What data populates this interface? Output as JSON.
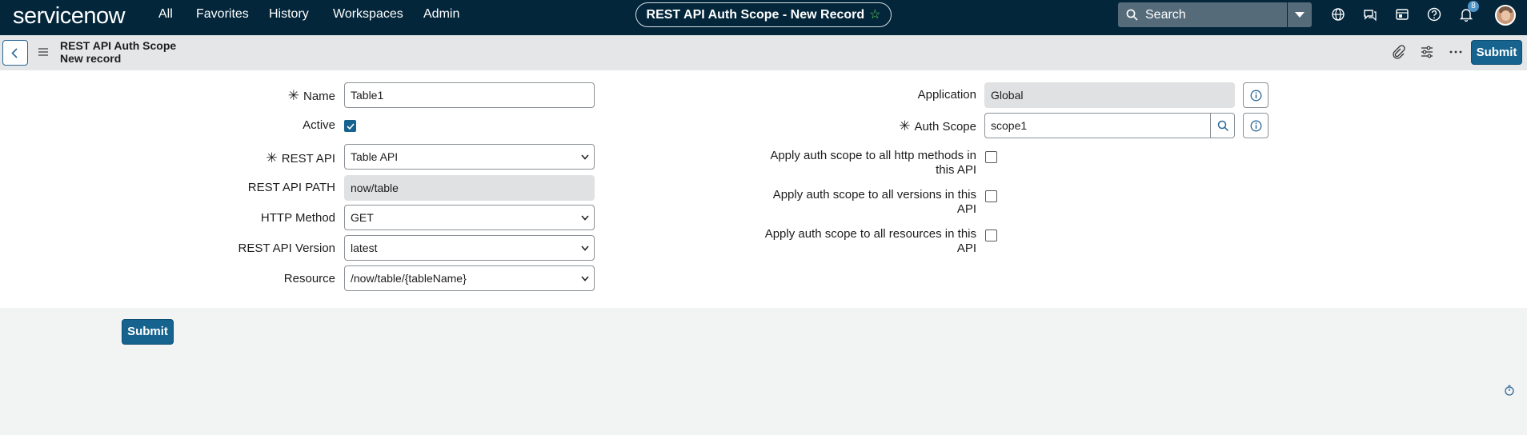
{
  "topbar": {
    "logo": "servicenow",
    "nav": [
      "All",
      "Favorites",
      "History",
      "Workspaces",
      "Admin"
    ],
    "record_title": "REST API Auth Scope - New Record",
    "search_placeholder": "Search",
    "notification_count": "8"
  },
  "subheader": {
    "title_line1": "REST API Auth Scope",
    "title_line2": "New record",
    "submit_label": "Submit"
  },
  "form": {
    "name_label": "Name",
    "name_value": "Table1",
    "active_label": "Active",
    "active_checked": true,
    "rest_api_label": "REST API",
    "rest_api_value": "Table API",
    "rest_api_path_label": "REST API PATH",
    "rest_api_path_value": "now/table",
    "http_method_label": "HTTP Method",
    "http_method_value": "GET",
    "rest_api_version_label": "REST API Version",
    "rest_api_version_value": "latest",
    "resource_label": "Resource",
    "resource_value": "/now/table/{tableName}",
    "application_label": "Application",
    "application_value": "Global",
    "auth_scope_label": "Auth Scope",
    "auth_scope_value": "scope1",
    "apply_methods_label_1": "Apply auth scope to all http methods in",
    "apply_methods_label_2": "this API",
    "apply_versions_label_1": "Apply auth scope to all versions in this",
    "apply_versions_label_2": "API",
    "apply_resources_label_1": "Apply auth scope to all resources in this",
    "apply_resources_label_2": "API"
  },
  "footer": {
    "submit_label": "Submit"
  },
  "colors": {
    "topbar": "#03263b",
    "primary": "#16638f",
    "star": "#62d84e"
  }
}
